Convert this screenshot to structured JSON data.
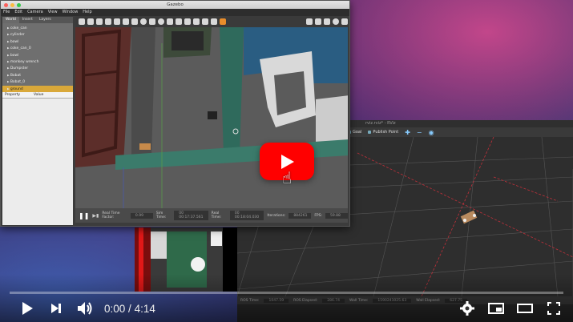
{
  "gazebo": {
    "window_title": "Gazebo",
    "menu": [
      "File",
      "Edit",
      "Camera",
      "View",
      "Window",
      "Help"
    ],
    "tabs": [
      "World",
      "Insert",
      "Layers"
    ],
    "tree_items": [
      "coke_can",
      "cylinder",
      "bowl",
      "coke_can_0",
      "bowl",
      "monkey wrench",
      "Dumpster",
      "Bobat",
      "Bobat_0",
      "ground"
    ],
    "props_headers": [
      "Property",
      "Value"
    ],
    "bottom": {
      "rtf_label": "Real Time Factor:",
      "rtf_value": "0.99",
      "sim_label": "Sim Time:",
      "sim_value": "00 00:17:37.561",
      "real_label": "Real Time:",
      "real_value": "00 00:18:04.030",
      "iter_label": "Iterations:",
      "iter_value": "884261",
      "fps_label": "FPS:",
      "fps_value": "59.88"
    }
  },
  "rviz": {
    "title": "rviz.rviz* - RViz",
    "toolbar": [
      "Goal",
      "Publish Point"
    ],
    "status": {
      "ros_time_label": "ROS Time:",
      "ros_time": "1047.59",
      "ros_elapsed_label": "ROS Elapsed:",
      "ros_elapsed": "286.74",
      "wall_time_label": "Wall Time:",
      "wall_time": "1590241025.63",
      "wall_elapsed_label": "Wall Elapsed:",
      "wall_elapsed": "627.75"
    }
  },
  "youtube": {
    "time_current": "0:00",
    "time_separator": "/",
    "time_total": "4:14",
    "progress": 0.0
  },
  "colors": {
    "yt_red": "#ff0000",
    "gazebo_highlight": "#d9a83a",
    "rviz_grid_red": "#c0303a"
  }
}
